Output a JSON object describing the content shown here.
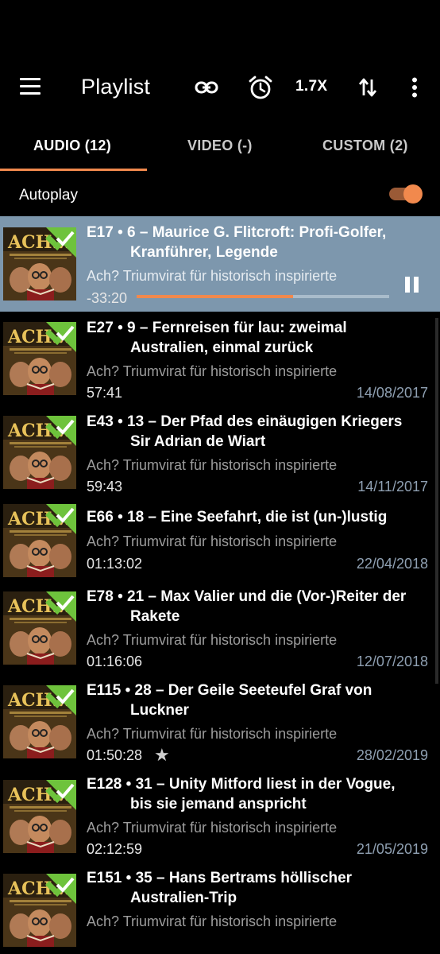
{
  "header": {
    "title": "Playlist",
    "speed_label": "1.7X",
    "icons": [
      "menu-icon",
      "link-icon",
      "alarm-icon",
      "sort-icon",
      "more-vert-icon"
    ]
  },
  "tabs": [
    {
      "label": "AUDIO (12)",
      "active": true
    },
    {
      "label": "VIDEO (-)",
      "active": false
    },
    {
      "label": "CUSTOM (2)",
      "active": false
    }
  ],
  "autoplay": {
    "label": "Autoplay",
    "enabled": true
  },
  "colors": {
    "accent": "#f1894d",
    "current_row_bg": "#7d97ad",
    "background": "#000000",
    "date_text": "#8fa0b2"
  },
  "episodes": [
    {
      "code": "E17",
      "title_line1": "E17 • 6 – Maurice G. Flitcroft: Profi-Golfer,",
      "title_line2": "Kranführer, Legende",
      "podcast": "Ach? Triumvirat für historisch inspirierte",
      "duration": "-33:20",
      "date": "",
      "playing": true,
      "progress": 0.62,
      "played": true
    },
    {
      "code": "E27",
      "title_line1": "E27 • 9 – Fernreisen für lau: zweimal",
      "title_line2": "Australien, einmal zurück",
      "podcast": "Ach? Triumvirat für historisch inspirierte",
      "duration": "57:41",
      "date": "14/08/2017",
      "played": true
    },
    {
      "code": "E43",
      "title_line1": "E43 • 13 – Der Pfad des einäugigen Kriegers",
      "title_line2": "Sir Adrian de Wiart",
      "podcast": "Ach? Triumvirat für historisch inspirierte",
      "duration": "59:43",
      "date": "14/11/2017",
      "played": true
    },
    {
      "code": "E66",
      "title_line1": "E66 • 18 – Eine Seefahrt, die ist (un-)lustig",
      "title_line2": "",
      "podcast": "Ach? Triumvirat für historisch inspirierte",
      "duration": "01:13:02",
      "date": "22/04/2018",
      "played": true
    },
    {
      "code": "E78",
      "title_line1": "E78 • 21 – Max Valier und die (Vor-)Reiter der",
      "title_line2": "Rakete",
      "podcast": "Ach? Triumvirat für historisch inspirierte",
      "duration": "01:16:06",
      "date": "12/07/2018",
      "played": true
    },
    {
      "code": "E115",
      "title_line1": "E115 • 28 – Der Geile Seeteufel Graf von",
      "title_line2": "Luckner",
      "podcast": "Ach? Triumvirat für historisch inspirierte",
      "duration": "01:50:28",
      "date": "28/02/2019",
      "favorite": true,
      "played": true
    },
    {
      "code": "E128",
      "title_line1": "E128 • 31 – Unity Mitford liest in der Vogue,",
      "title_line2": "bis sie jemand anspricht",
      "podcast": "Ach? Triumvirat für historisch inspirierte",
      "duration": "02:12:59",
      "date": "21/05/2019",
      "played": true
    },
    {
      "code": "E151",
      "title_line1": "E151 • 35 – Hans Bertrams höllischer",
      "title_line2": "Australien-Trip",
      "podcast": "Ach? Triumvirat für historisch inspirierte",
      "duration": "",
      "date": "",
      "played": true
    }
  ],
  "artwork": {
    "logo_text": "ACH..."
  }
}
